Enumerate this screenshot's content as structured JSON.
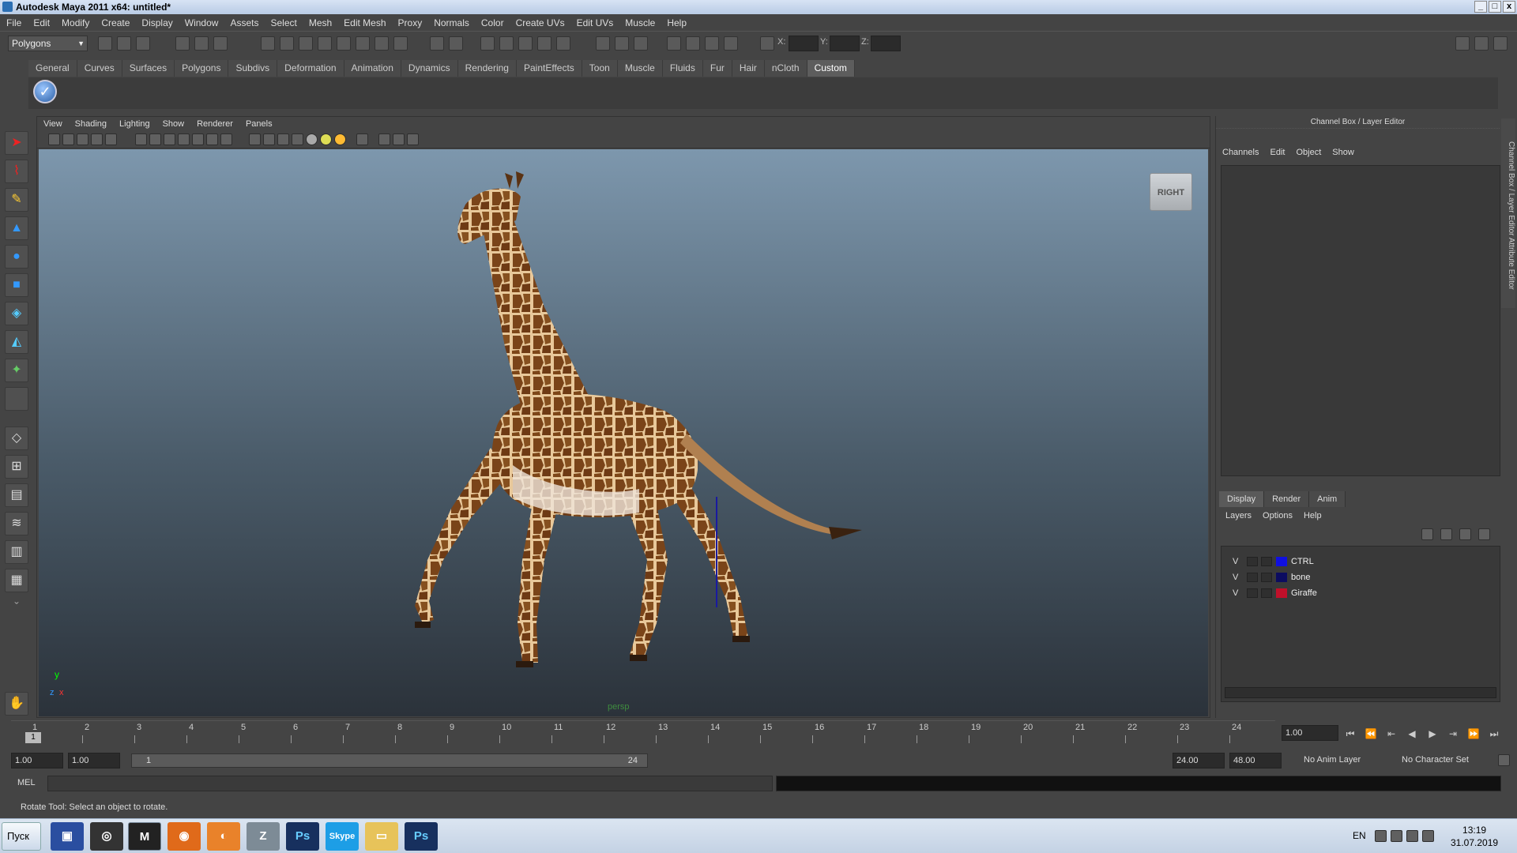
{
  "window": {
    "title": "Autodesk Maya 2011 x64: untitled*",
    "controls": [
      "_",
      "□",
      "x"
    ]
  },
  "menubar": [
    "File",
    "Edit",
    "Modify",
    "Create",
    "Display",
    "Window",
    "Assets",
    "Select",
    "Mesh",
    "Edit Mesh",
    "Proxy",
    "Normals",
    "Color",
    "Create UVs",
    "Edit UVs",
    "Muscle",
    "Help"
  ],
  "statusline": {
    "mode": "Polygons",
    "x_label": "X:",
    "y_label": "Y:",
    "z_label": "Z:"
  },
  "shelf": {
    "tabs": [
      "General",
      "Curves",
      "Surfaces",
      "Polygons",
      "Subdivs",
      "Deformation",
      "Animation",
      "Dynamics",
      "Rendering",
      "PaintEffects",
      "Toon",
      "Muscle",
      "Fluids",
      "Fur",
      "Hair",
      "nCloth",
      "Custom"
    ],
    "active": "Custom"
  },
  "viewport": {
    "menu": [
      "View",
      "Shading",
      "Lighting",
      "Show",
      "Renderer",
      "Panels"
    ],
    "viewcube": "RIGHT",
    "camera": "persp",
    "axis": {
      "y": "y",
      "x": "x",
      "z": "z"
    }
  },
  "channelbox": {
    "title": "Channel Box / Layer Editor",
    "menu": [
      "Channels",
      "Edit",
      "Object",
      "Show"
    ],
    "side_tabs": "Channel Box / Layer Editor     Attribute Editor"
  },
  "layereditor": {
    "tabs": [
      "Display",
      "Render",
      "Anim"
    ],
    "active": "Display",
    "menu": [
      "Layers",
      "Options",
      "Help"
    ],
    "layers": [
      {
        "v": "V",
        "name": "CTRL",
        "color": "#1010e0"
      },
      {
        "v": "V",
        "name": "bone",
        "color": "#0c0c60"
      },
      {
        "v": "V",
        "name": "Giraffe",
        "color": "#c0102a"
      }
    ]
  },
  "timeline": {
    "ticks": [
      "1",
      "2",
      "3",
      "4",
      "5",
      "6",
      "7",
      "8",
      "9",
      "10",
      "11",
      "12",
      "13",
      "14",
      "15",
      "16",
      "17",
      "18",
      "19",
      "20",
      "21",
      "22",
      "23",
      "24"
    ],
    "current_marker": "1",
    "current_frame": "1.00"
  },
  "range": {
    "start": "1.00",
    "playback_start": "1.00",
    "slider_start": "1",
    "slider_end": "24",
    "playback_end": "24.00",
    "end": "48.00",
    "anim_layer": "No Anim Layer",
    "character_set": "No Character Set"
  },
  "commandline": {
    "label": "MEL"
  },
  "helpline": "Rotate Tool: Select an object to rotate.",
  "taskbar": {
    "start": "Пуск",
    "apps": [
      "save-icon",
      "cinema4d-icon",
      "maya-icon",
      "firefox-icon",
      "blender-icon",
      "zbrush-icon",
      "Ps",
      "Skype",
      "explorer-icon",
      "Ps"
    ],
    "lang": "EN",
    "time": "13:19",
    "date": "31.07.2019"
  }
}
